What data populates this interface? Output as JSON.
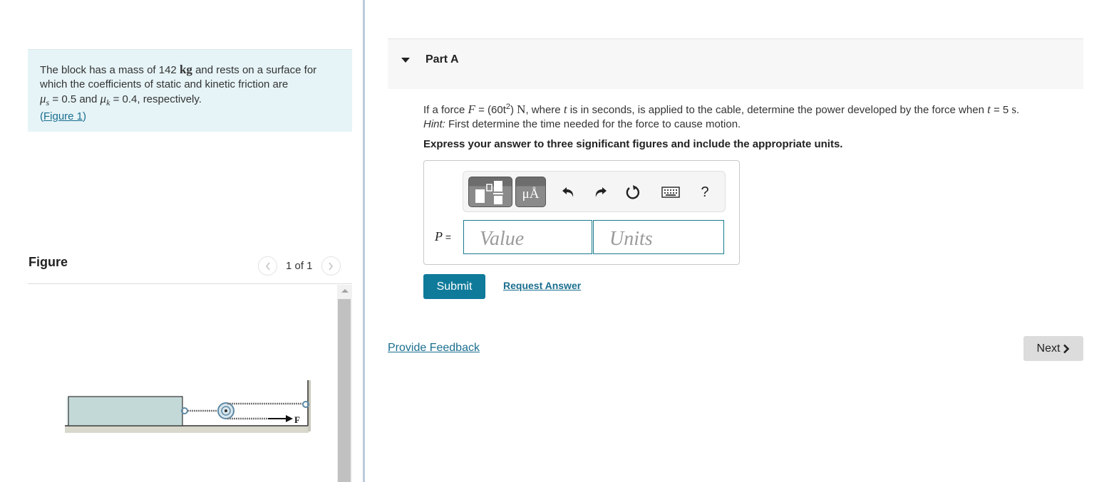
{
  "intro": {
    "text_1": "The block has a mass of 142 ",
    "unit_kg": "kg",
    "text_2": " and rests on a surface for which the coefficients of static and kinetic friction are",
    "mu_s_symbol": "μ",
    "mu_s_sub": "s",
    "mu_s_value": " = 0.5 and ",
    "mu_k_symbol": "μ",
    "mu_k_sub": "k",
    "mu_k_value": " = 0.4, respectively.",
    "figure_link_open": "(",
    "figure_link": "Figure 1",
    "figure_link_close": ")"
  },
  "figure": {
    "title": "Figure",
    "counter": "1 of 1",
    "prev_icon": "chevron-left",
    "next_icon": "chevron-right",
    "force_label": "F"
  },
  "part": {
    "title": "Part A",
    "question": {
      "p1": "If a force ",
      "F": "F",
      "p2": " = (60t",
      "exp": "2",
      "p3": ") ",
      "N": "N",
      "p4": ", where ",
      "t1": "t",
      "p5": " is in seconds, is applied to the cable, determine the power developed by the force when ",
      "t2": "t",
      "p6": " = 5 ",
      "s": "s",
      "p7": "."
    },
    "hint_label": "Hint:",
    "hint_text": " First determine the time needed for the force to cause motion.",
    "instruction": "Express your answer to three significant figures and include the appropriate units."
  },
  "answer": {
    "toolbar": {
      "templates_icon": "fraction-templates",
      "units_label": "μÅ",
      "undo_icon": "undo",
      "redo_icon": "redo",
      "reset_icon": "reset",
      "keyboard_icon": "keyboard",
      "help_label": "?"
    },
    "variable": "P",
    "equals": " =",
    "value_placeholder": "Value",
    "units_placeholder": "Units"
  },
  "actions": {
    "submit": "Submit",
    "request_answer": "Request Answer",
    "provide_feedback": "Provide Feedback",
    "next": "Next"
  },
  "colors": {
    "accent": "#0f7a9a",
    "link": "#1a6e8f",
    "intro_bg": "#e6f4f7"
  }
}
